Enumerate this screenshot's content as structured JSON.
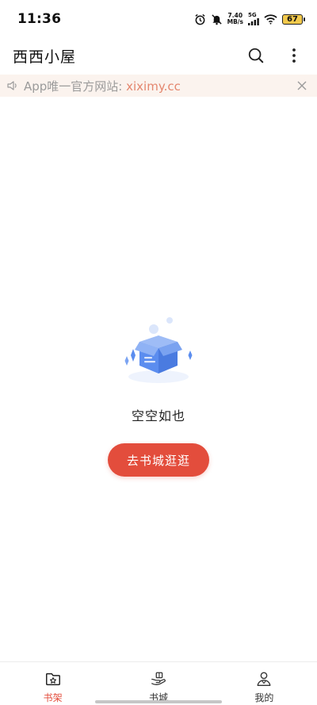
{
  "status_bar": {
    "time": "11:36",
    "net_speed_value": "7.40",
    "net_speed_unit": "MB/s",
    "signal_label": "5G",
    "battery": "67"
  },
  "app_bar": {
    "title": "西西小屋",
    "icons": [
      "search-icon",
      "more-vertical-icon"
    ]
  },
  "notice": {
    "prefix": "App唯一官方网站: ",
    "link": "xiximy.cc",
    "icons": [
      "speaker-icon",
      "close-icon"
    ]
  },
  "empty_state": {
    "message": "空空如也",
    "button_label": "去书城逛逛"
  },
  "bottom_nav": {
    "items": [
      {
        "label": "书架",
        "icon": "bookshelf-icon",
        "active": true
      },
      {
        "label": "书城",
        "icon": "bookstore-icon",
        "active": false
      },
      {
        "label": "我的",
        "icon": "profile-icon",
        "active": false
      }
    ]
  },
  "colors": {
    "accent": "#e34d3c",
    "notice_bg": "#fbf3ee",
    "notice_link": "#e4866e",
    "illustration_blue": "#5b8def"
  }
}
